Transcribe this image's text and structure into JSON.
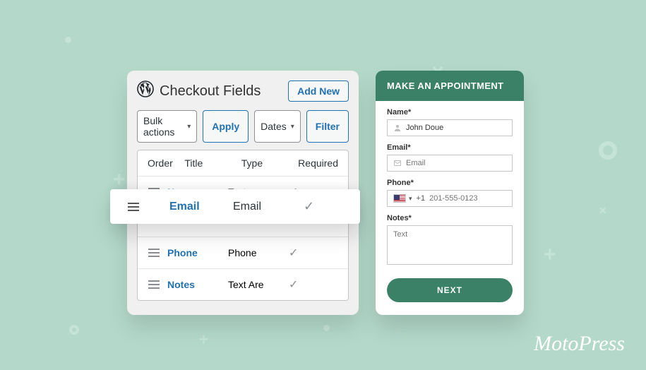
{
  "admin": {
    "title": "Checkout Fields",
    "add_new": "Add New",
    "toolbar": {
      "bulk": "Bulk actions",
      "apply": "Apply",
      "dates": "Dates",
      "filter": "Filter"
    },
    "columns": {
      "order": "Order",
      "title": "Title",
      "type": "Type",
      "required": "Required"
    },
    "rows": [
      {
        "title": "Name",
        "type": "Text",
        "required": true
      },
      {
        "title": "Email",
        "type": "Email",
        "required": true
      },
      {
        "title": "Phone",
        "type": "Phone",
        "required": true
      },
      {
        "title": "Notes",
        "type": "Text Are",
        "required": true
      }
    ],
    "highlight": {
      "title": "Email",
      "type": "Email",
      "required": true
    }
  },
  "form": {
    "heading": "MAKE AN APPOINTMENT",
    "name": {
      "label": "Name*",
      "value": "John Doue"
    },
    "email": {
      "label": "Email*",
      "placeholder": "Email"
    },
    "phone": {
      "label": "Phone*",
      "prefix": "+1",
      "placeholder": "201-555-0123"
    },
    "notes": {
      "label": "Notes*",
      "placeholder": "Text"
    },
    "submit": "NEXT"
  },
  "brand": "MotoPress"
}
